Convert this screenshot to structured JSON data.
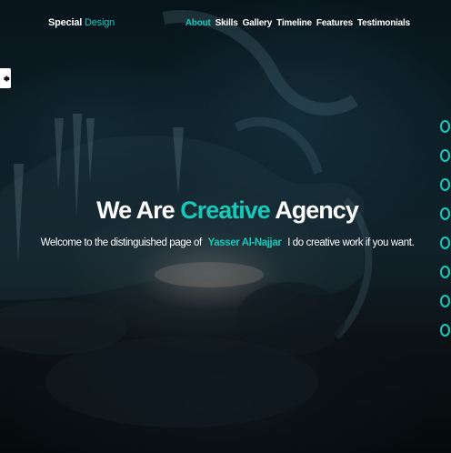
{
  "header": {
    "logo_primary": "Special",
    "logo_accent": "Design"
  },
  "nav": {
    "items": [
      "About",
      "Skills",
      "Gallery",
      "Timeline",
      "Features",
      "Testimonials"
    ],
    "active": "About"
  },
  "hero": {
    "title_start": "We Are",
    "title_accent": "Creative",
    "title_end": "Agency",
    "text_before": "Welcome to the distinguished page of",
    "name": "Yasser Al-Najjar",
    "text_after": "I do creative work if you want."
  },
  "settings": {
    "icon": "gear-icon"
  },
  "bullets": {
    "count": 8
  },
  "colors": {
    "accent": "#19c8b9",
    "text": "#ffffff"
  }
}
